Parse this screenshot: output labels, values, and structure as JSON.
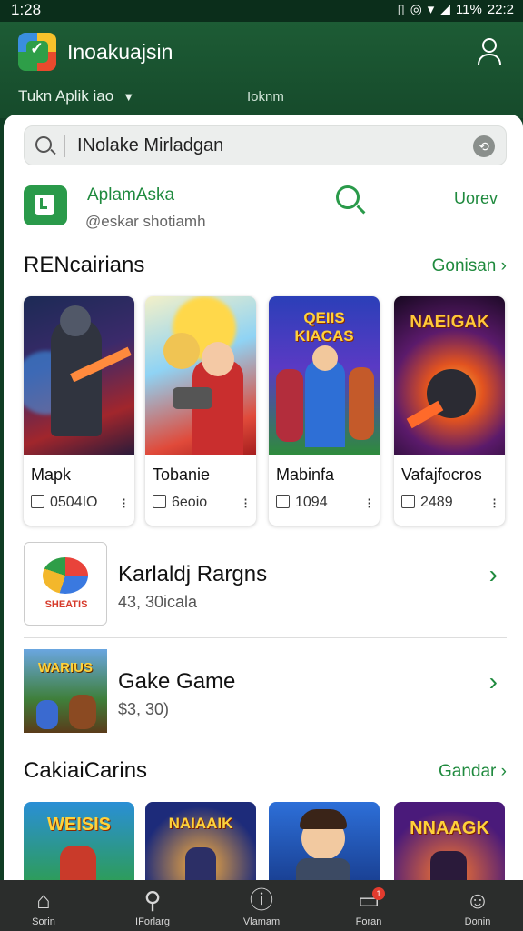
{
  "status_bar": {
    "time": "1:28",
    "battery": "11%",
    "clock_right": "22:2"
  },
  "app_bar": {
    "title": "Inoakuajsin",
    "logo_icon": "app-logo-icon",
    "profile_icon": "profile-icon"
  },
  "tabs": [
    {
      "label": "Tukn Aplik iao"
    },
    {
      "label": "Ioknm"
    }
  ],
  "search": {
    "value": "INolake Mirladgan"
  },
  "featured": {
    "name": "AplamAska",
    "handle": "@eskar shotiamh",
    "action": "Uorev"
  },
  "section1": {
    "title": "RENcairians",
    "link": "Gonisan",
    "cards": [
      {
        "name": "Mapk",
        "meta": "0504IO",
        "banner": ""
      },
      {
        "name": "Tobanie",
        "meta": "6eoio",
        "banner": ""
      },
      {
        "name": "Mabinfa",
        "meta": "1094",
        "banner": "QEIIS KIACAS"
      },
      {
        "name": "Vafajfocros",
        "meta": "2489",
        "banner": "NAEIGAK"
      }
    ]
  },
  "list": [
    {
      "title": "Karlaldj Rargns",
      "sub": "43, 30icala",
      "icon_text": "SHEATIS"
    },
    {
      "title": "Gake Game",
      "sub": "$3, 30)",
      "icon_text": "WARIUS"
    }
  ],
  "section2": {
    "title": "CakiaiCarins",
    "link": "Gandar",
    "cards": [
      {
        "banner": "WEISIS"
      },
      {
        "banner": "NAIAAIK"
      },
      {
        "banner": ""
      },
      {
        "banner": "NNAAGK"
      }
    ]
  },
  "bottom_nav": [
    {
      "label": "Sorin",
      "icon": "home-icon"
    },
    {
      "label": "IForlarg",
      "icon": "search-icon"
    },
    {
      "label": "Vlamam",
      "icon": "alert-icon"
    },
    {
      "label": "Foran",
      "icon": "inbox-icon",
      "badge": "1"
    },
    {
      "label": "Donin",
      "icon": "account-icon"
    }
  ],
  "colors": {
    "brand_green": "#1f8a3e",
    "app_bar": "#1d5c35",
    "nav_bg": "#2b2d2c"
  }
}
